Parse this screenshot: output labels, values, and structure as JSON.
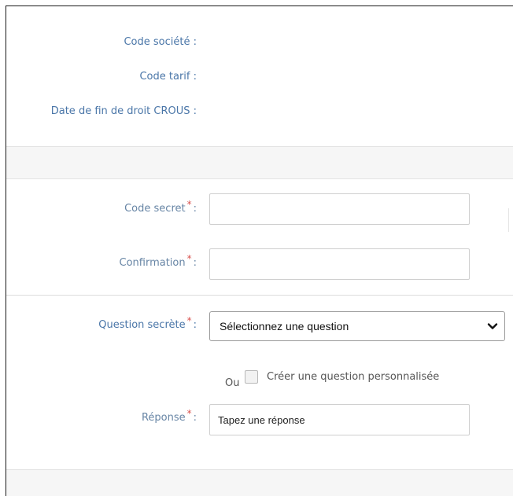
{
  "info": {
    "code_societe_label": "Code société :",
    "code_tarif_label": "Code tarif :",
    "date_fin_droit_label": "Date de fin de droit CROUS :"
  },
  "form": {
    "code_secret": {
      "label": "Code secret",
      "required_mark": "*",
      "colon": ":",
      "value": ""
    },
    "confirmation": {
      "label": "Confirmation",
      "required_mark": "*",
      "colon": ":",
      "value": ""
    },
    "question_secrete": {
      "label": "Question secrète",
      "required_mark": "*",
      "colon": ":",
      "selected": "Sélectionnez une question"
    },
    "custom_question": {
      "or_text": "Ou",
      "label": "Créer une question personnalisée",
      "checked": false
    },
    "reponse": {
      "label": "Réponse",
      "required_mark": "*",
      "colon": ":",
      "placeholder": "Tapez une réponse"
    }
  },
  "colors": {
    "label_blue": "#4a76a8",
    "required_red": "#d9534f",
    "band_gray": "#f6f6f6"
  }
}
